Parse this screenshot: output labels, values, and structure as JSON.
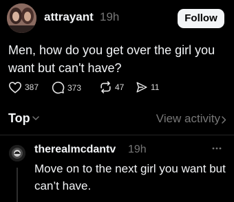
{
  "post": {
    "username": "attrayant",
    "time": "19h",
    "follow_label": "Follow",
    "text": "Men, how do you get over the girl you want but can't have?",
    "actions": {
      "likes": "387",
      "replies": "373",
      "reposts": "47",
      "shares": "11"
    },
    "icons": {
      "like": "heart-icon",
      "reply": "comment-icon",
      "repost": "repost-icon",
      "share": "send-icon"
    }
  },
  "tabs": {
    "sort_label": "Top",
    "view_activity_label": "View activity"
  },
  "reply": {
    "username": "therealmcdantv",
    "time": "19h",
    "text": "Move on to the next girl you want but can’t have."
  },
  "colors": {
    "background": "#000000",
    "text": "#f3f5f7",
    "muted": "#777777",
    "button_bg": "#f3f5f7"
  }
}
